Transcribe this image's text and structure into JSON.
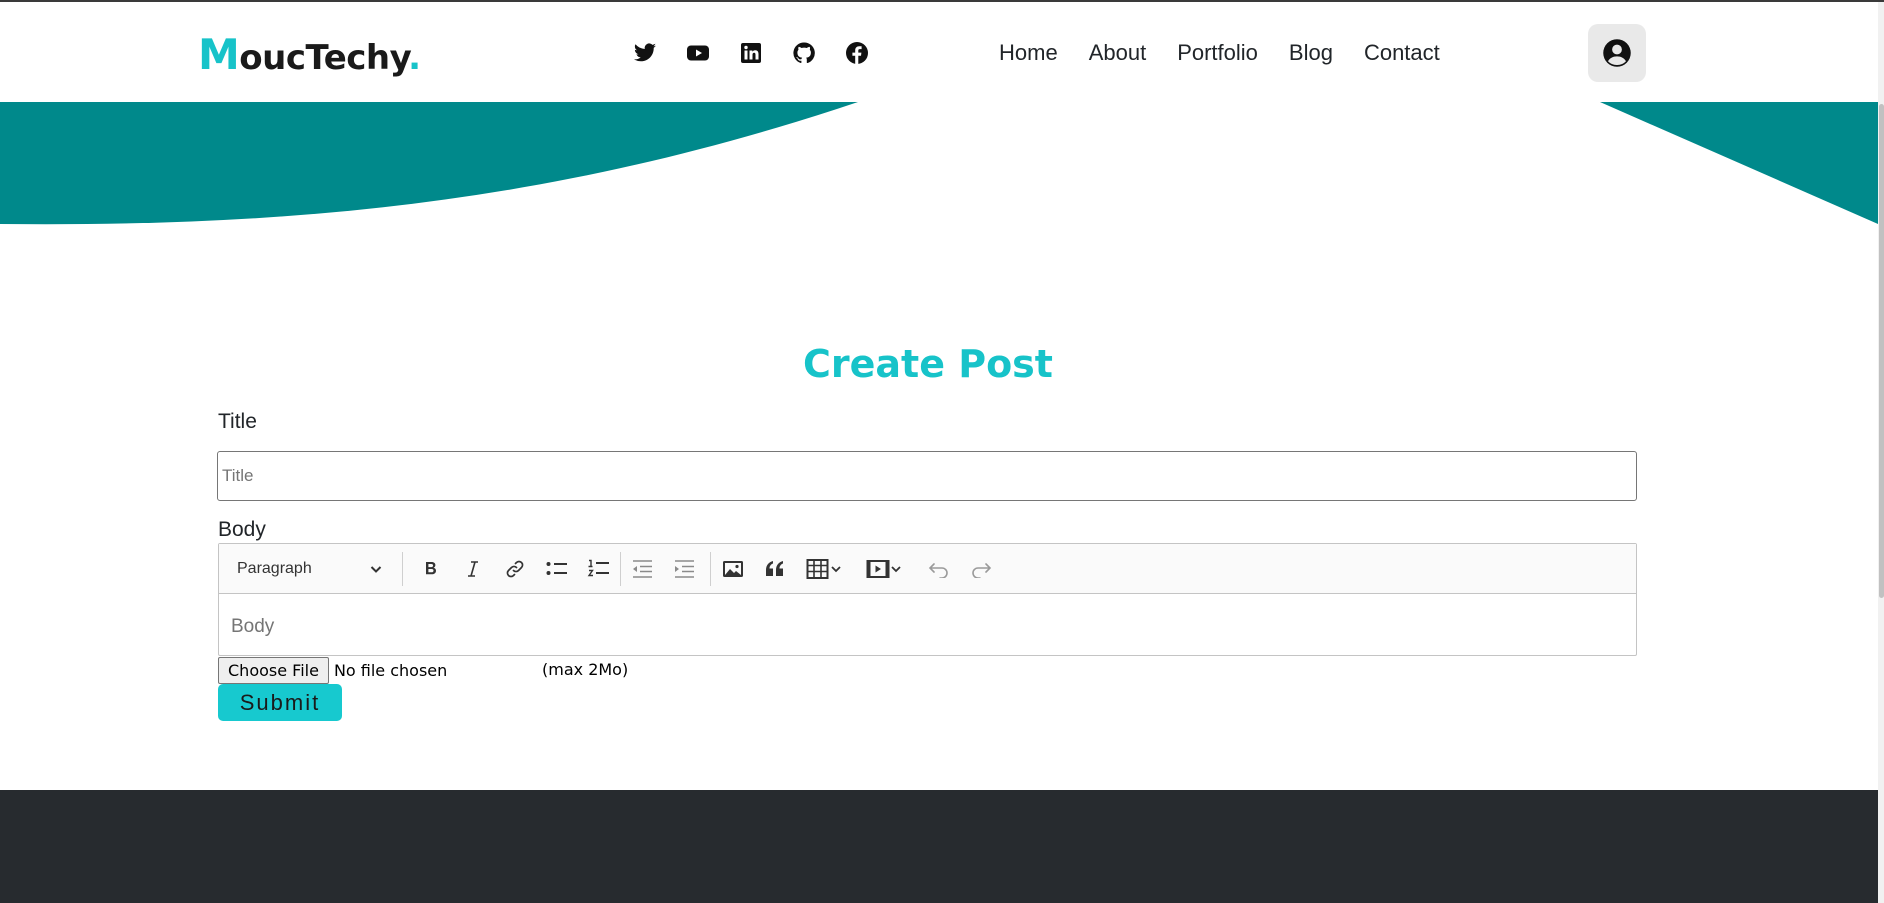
{
  "brand": {
    "first_letter": "M",
    "rest": "oucTechy",
    "dot": ".",
    "accent_color": "#17c3c9"
  },
  "socials": [
    {
      "icon": "twitter-icon"
    },
    {
      "icon": "youtube-icon"
    },
    {
      "icon": "linkedin-icon"
    },
    {
      "icon": "github-icon"
    },
    {
      "icon": "facebook-icon"
    }
  ],
  "nav": {
    "items": [
      "Home",
      "About",
      "Portfolio",
      "Blog",
      "Contact"
    ]
  },
  "user": {
    "icon": "user-circle-icon"
  },
  "colors": {
    "wave": "#00898b",
    "submit": "#17c9cf",
    "footer": "#272b2f"
  },
  "form": {
    "heading": "Create Post",
    "title_label": "Title",
    "title_placeholder": "Title",
    "title_value": "",
    "body_label": "Body",
    "body_placeholder": "Body",
    "format_selected": "Paragraph",
    "toolbar_icons": [
      "bold-icon",
      "italic-icon",
      "link-icon",
      "bulleted-list-icon",
      "numbered-list-icon",
      "outdent-icon",
      "indent-icon",
      "image-icon",
      "blockquote-icon",
      "table-icon",
      "media-icon",
      "undo-icon",
      "redo-icon"
    ],
    "choose_file_label": "Choose File",
    "file_status": "No file chosen",
    "max_note": "(max 2Mo)",
    "submit_label": "Submit"
  }
}
